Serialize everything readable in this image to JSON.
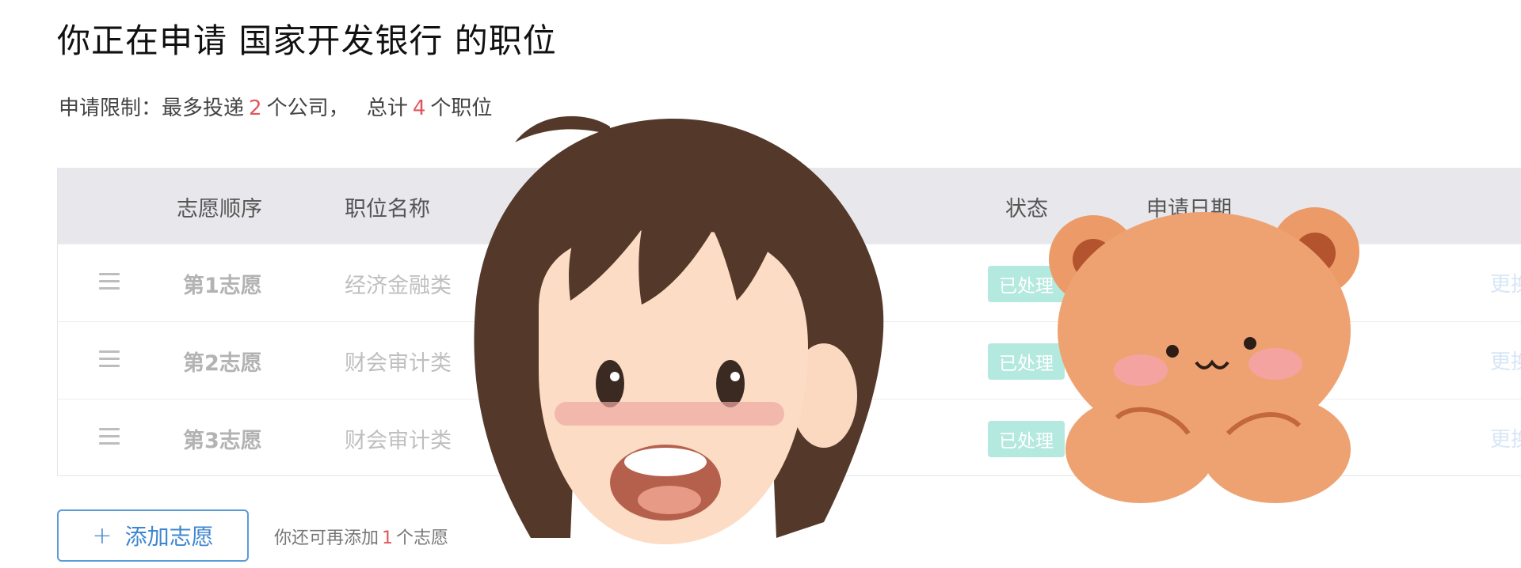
{
  "header": {
    "title": "你正在申请 国家开发银行 的职位"
  },
  "limits": {
    "prefix": "申请限制：最多投递",
    "company_count": "2",
    "company_suffix": "个公司，",
    "total_prefix": "总计",
    "position_count": "4",
    "position_suffix": "个职位"
  },
  "table": {
    "headers": {
      "order": "志愿顺序",
      "position": "职位名称",
      "status": "状态",
      "date": "申请日期"
    },
    "rows": [
      {
        "order": "第1志愿",
        "position": "经济金融类",
        "status": "已处理",
        "action": "更换"
      },
      {
        "order": "第2志愿",
        "position": "财会审计类",
        "status": "已处理",
        "action": "更换"
      },
      {
        "order": "第3志愿",
        "position": "财会审计类",
        "status": "已处理",
        "action": "更换"
      }
    ]
  },
  "footer": {
    "add_button_label": "添加志愿",
    "hint_prefix": "你还可再添加",
    "hint_count": "1",
    "hint_suffix": "个志愿"
  },
  "icons": {
    "drag_handle": "drag-handle-icon",
    "plus": "plus-icon"
  },
  "colors": {
    "accent": "#3f86d0",
    "count_red": "#e0575b",
    "status_badge": "#b4e9df",
    "header_bg": "#e8e8ec"
  }
}
